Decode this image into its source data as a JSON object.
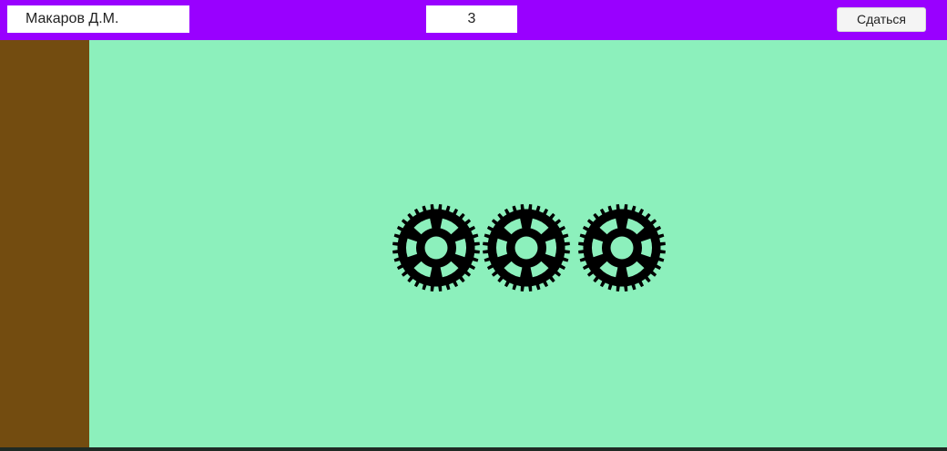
{
  "header": {
    "player_name": "Макаров Д.М.",
    "counter": "3",
    "surrender_label": "Сдаться"
  },
  "colors": {
    "topbar": "#9900ff",
    "sidebar": "#734c10",
    "field": "#8cf0bc",
    "gear": "#000000"
  },
  "field": {
    "gears": [
      {
        "icon": "gear-icon"
      },
      {
        "icon": "gear-icon"
      },
      {
        "icon": "gear-icon"
      }
    ]
  }
}
